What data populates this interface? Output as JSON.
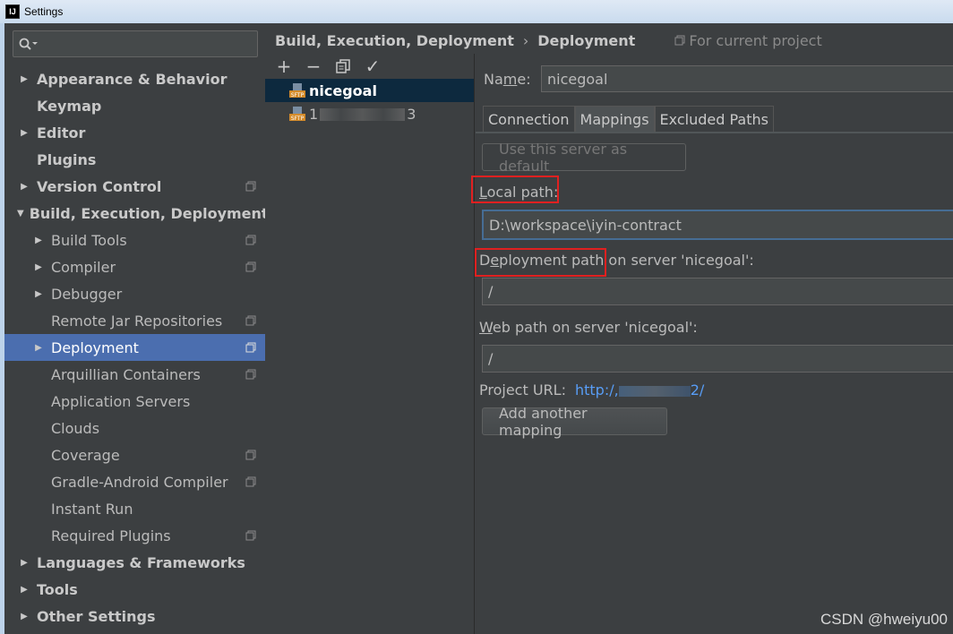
{
  "window": {
    "title": "Settings",
    "app_icon": "IJ"
  },
  "search": {
    "icon": "search-icon"
  },
  "sidebar": {
    "items": [
      {
        "label": "Appearance & Behavior",
        "level": 0,
        "arrow": "▶",
        "bold": true,
        "project": false
      },
      {
        "label": "Keymap",
        "level": 0,
        "arrow": "",
        "bold": true,
        "project": false
      },
      {
        "label": "Editor",
        "level": 0,
        "arrow": "▶",
        "bold": true,
        "project": false
      },
      {
        "label": "Plugins",
        "level": 0,
        "arrow": "",
        "bold": true,
        "project": false
      },
      {
        "label": "Version Control",
        "level": 0,
        "arrow": "▶",
        "bold": true,
        "project": true
      },
      {
        "label": "Build, Execution, Deployment",
        "level": 0,
        "arrow": "▼",
        "bold": true,
        "project": false
      },
      {
        "label": "Build Tools",
        "level": 1,
        "arrow": "▶",
        "bold": false,
        "project": true
      },
      {
        "label": "Compiler",
        "level": 1,
        "arrow": "▶",
        "bold": false,
        "project": true
      },
      {
        "label": "Debugger",
        "level": 1,
        "arrow": "▶",
        "bold": false,
        "project": false
      },
      {
        "label": "Remote Jar Repositories",
        "level": 1,
        "arrow": "",
        "bold": false,
        "project": true
      },
      {
        "label": "Deployment",
        "level": 1,
        "arrow": "▶",
        "bold": false,
        "project": true,
        "selected": true
      },
      {
        "label": "Arquillian Containers",
        "level": 1,
        "arrow": "",
        "bold": false,
        "project": true
      },
      {
        "label": "Application Servers",
        "level": 1,
        "arrow": "",
        "bold": false,
        "project": false
      },
      {
        "label": "Clouds",
        "level": 1,
        "arrow": "",
        "bold": false,
        "project": false
      },
      {
        "label": "Coverage",
        "level": 1,
        "arrow": "",
        "bold": false,
        "project": true
      },
      {
        "label": "Gradle-Android Compiler",
        "level": 1,
        "arrow": "",
        "bold": false,
        "project": true
      },
      {
        "label": "Instant Run",
        "level": 1,
        "arrow": "",
        "bold": false,
        "project": false
      },
      {
        "label": "Required Plugins",
        "level": 1,
        "arrow": "",
        "bold": false,
        "project": true
      },
      {
        "label": "Languages & Frameworks",
        "level": 0,
        "arrow": "▶",
        "bold": true,
        "project": false
      },
      {
        "label": "Tools",
        "level": 0,
        "arrow": "▶",
        "bold": true,
        "project": false
      },
      {
        "label": "Other Settings",
        "level": 0,
        "arrow": "▶",
        "bold": true,
        "project": false
      }
    ]
  },
  "breadcrumb": {
    "parent": "Build, Execution, Deployment",
    "separator": "›",
    "current": "Deployment",
    "scope": "For current project"
  },
  "servers": {
    "toolbar": {
      "add": "+",
      "remove": "−",
      "copy": "copy-icon",
      "apply": "✓"
    },
    "items": [
      {
        "name": "nicegoal",
        "selected": true
      },
      {
        "name_prefix": "1",
        "name_suffix": "3",
        "selected": false
      }
    ]
  },
  "config": {
    "name_label_pre": "Na",
    "name_label_u": "m",
    "name_label_post": "e:",
    "name_value": "nicegoal",
    "tabs": [
      "Connection",
      "Mappings",
      "Excluded Paths"
    ],
    "active_tab": "Mappings",
    "default_button": "Use this server as default",
    "local_path_label_u": "L",
    "local_path_label": "ocal path:",
    "local_path_value": "D:\\workspace\\iyin-contract",
    "deploy_label_pre": "D",
    "deploy_label_u": "e",
    "deploy_label_post": "ployment path on server 'nicegoal':",
    "deploy_value": "/",
    "web_label_u": "W",
    "web_label": "eb path on server 'nicegoal':",
    "web_value": "/",
    "project_url_label": "Project URL:",
    "project_url_prefix": "http:/,",
    "project_url_suffix": "2/",
    "add_mapping_button": "Add another mapping"
  },
  "watermark": "CSDN @hweiyu00"
}
